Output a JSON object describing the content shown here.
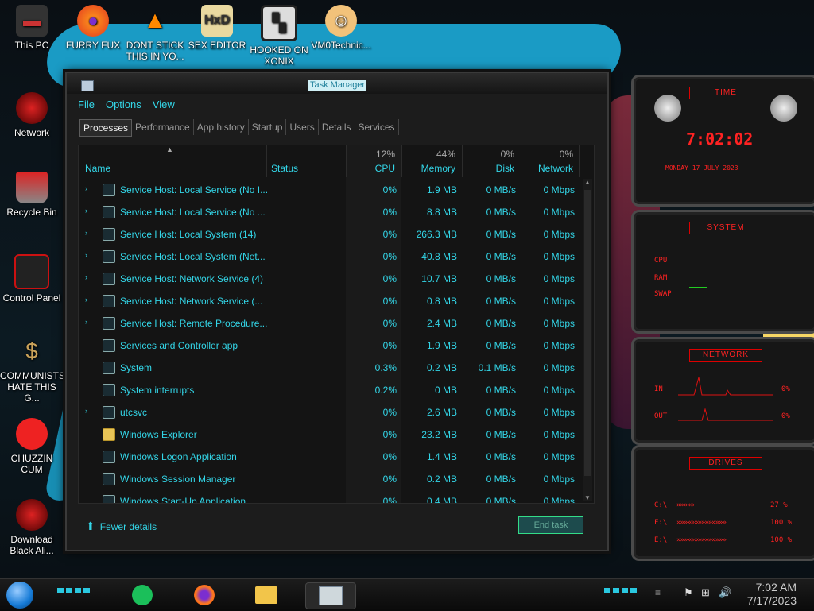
{
  "desktop": {
    "icons": [
      {
        "label": "This PC",
        "icon": "computer-icon"
      },
      {
        "label": "FURRY FUX",
        "icon": "firefox-icon"
      },
      {
        "label": "DONT STICK THIS IN YO...",
        "icon": "vlc-cone-icon"
      },
      {
        "label": "SEX EDITOR",
        "icon": "hex-editor-icon"
      },
      {
        "label": "HOOKED ON XONIX",
        "icon": "xonix-game-icon"
      },
      {
        "label": "VM0Technic...",
        "icon": "doctor-avatar-icon"
      },
      {
        "label": "Network",
        "icon": "alien-network-icon"
      },
      {
        "label": "Recycle Bin",
        "icon": "recycle-bin-icon"
      },
      {
        "label": "Control Panel",
        "icon": "control-panel-icon"
      },
      {
        "label": "COMMUNISTS HATE THIS G...",
        "icon": "money-bag-icon"
      },
      {
        "label": "CHUZZIN CUM",
        "icon": "chuzzle-icon"
      },
      {
        "label": "Download Black Ali...",
        "icon": "alien-download-icon"
      }
    ]
  },
  "task_manager": {
    "title": "Task Manager",
    "menu": [
      "File",
      "Options",
      "View"
    ],
    "tabs": [
      "Processes",
      "Performance",
      "App history",
      "Startup",
      "Users",
      "Details",
      "Services"
    ],
    "active_tab": "Processes",
    "columns": {
      "name": "Name",
      "status": "Status",
      "cpu": {
        "label": "CPU",
        "pct": "12%"
      },
      "memory": {
        "label": "Memory",
        "pct": "44%"
      },
      "disk": {
        "label": "Disk",
        "pct": "0%"
      },
      "network": {
        "label": "Network",
        "pct": "0%"
      }
    },
    "rows": [
      {
        "name": "Service Host: Local Service (No I...",
        "expandable": true,
        "icon": "gear-icon",
        "cpu": "0%",
        "memory": "1.9 MB",
        "disk": "0 MB/s",
        "network": "0 Mbps"
      },
      {
        "name": "Service Host: Local Service (No ...",
        "expandable": true,
        "icon": "gear-icon",
        "cpu": "0%",
        "memory": "8.8 MB",
        "disk": "0 MB/s",
        "network": "0 Mbps"
      },
      {
        "name": "Service Host: Local System (14)",
        "expandable": true,
        "icon": "gear-icon",
        "cpu": "0%",
        "memory": "266.3 MB",
        "disk": "0 MB/s",
        "network": "0 Mbps"
      },
      {
        "name": "Service Host: Local System (Net...",
        "expandable": true,
        "icon": "gear-icon",
        "cpu": "0%",
        "memory": "40.8 MB",
        "disk": "0 MB/s",
        "network": "0 Mbps"
      },
      {
        "name": "Service Host: Network Service (4)",
        "expandable": true,
        "icon": "gear-icon",
        "cpu": "0%",
        "memory": "10.7 MB",
        "disk": "0 MB/s",
        "network": "0 Mbps"
      },
      {
        "name": "Service Host: Network Service (...",
        "expandable": true,
        "icon": "gear-icon",
        "cpu": "0%",
        "memory": "0.8 MB",
        "disk": "0 MB/s",
        "network": "0 Mbps"
      },
      {
        "name": "Service Host: Remote Procedure...",
        "expandable": true,
        "icon": "gear-icon",
        "cpu": "0%",
        "memory": "2.4 MB",
        "disk": "0 MB/s",
        "network": "0 Mbps"
      },
      {
        "name": "Services and Controller app",
        "expandable": false,
        "icon": "app-window-icon",
        "cpu": "0%",
        "memory": "1.9 MB",
        "disk": "0 MB/s",
        "network": "0 Mbps"
      },
      {
        "name": "System",
        "expandable": false,
        "icon": "app-window-icon",
        "cpu": "0.3%",
        "memory": "0.2 MB",
        "disk": "0.1 MB/s",
        "network": "0 Mbps"
      },
      {
        "name": "System interrupts",
        "expandable": false,
        "icon": "app-window-icon",
        "cpu": "0.2%",
        "memory": "0 MB",
        "disk": "0 MB/s",
        "network": "0 Mbps"
      },
      {
        "name": "utcsvc",
        "expandable": true,
        "icon": "gear-icon",
        "cpu": "0%",
        "memory": "2.6 MB",
        "disk": "0 MB/s",
        "network": "0 Mbps"
      },
      {
        "name": "Windows Explorer",
        "expandable": false,
        "icon": "folder-icon",
        "cpu": "0%",
        "memory": "23.2 MB",
        "disk": "0 MB/s",
        "network": "0 Mbps"
      },
      {
        "name": "Windows Logon Application",
        "expandable": false,
        "icon": "app-window-icon",
        "cpu": "0%",
        "memory": "1.4 MB",
        "disk": "0 MB/s",
        "network": "0 Mbps"
      },
      {
        "name": "Windows Session Manager",
        "expandable": false,
        "icon": "app-window-icon",
        "cpu": "0%",
        "memory": "0.2 MB",
        "disk": "0 MB/s",
        "network": "0 Mbps"
      },
      {
        "name": "Windows Start-Up Application",
        "expandable": false,
        "icon": "app-window-icon",
        "cpu": "0%",
        "memory": "0.4 MB",
        "disk": "0 MB/s",
        "network": "0 Mbps"
      }
    ],
    "fewer_details": "Fewer details",
    "end_task": "End task"
  },
  "widgets": {
    "time": {
      "title": "TIME",
      "time": "7:02:02",
      "date": "MONDAY 17 JULY 2023"
    },
    "system": {
      "title": "SYSTEM",
      "labels": [
        "CPU",
        "RAM",
        "SWAP"
      ]
    },
    "network": {
      "title": "NETWORK",
      "in_label": "IN",
      "in_value": "0%",
      "out_label": "OUT",
      "out_value": "0%"
    },
    "drives": {
      "title": "DRIVES",
      "items": [
        {
          "label": "C:\\",
          "value": "27 %"
        },
        {
          "label": "F:\\",
          "value": "100 %"
        },
        {
          "label": "E:\\",
          "value": "100 %"
        }
      ]
    },
    "accent": "#ff2222"
  },
  "taskbar": {
    "apps": [
      "notes-app-icon",
      "firefox-icon",
      "file-explorer-icon",
      "task-manager-icon"
    ],
    "clock_time": "7:02 AM",
    "clock_date": "7/17/2023"
  },
  "colors": {
    "accent_cyan": "#33d6e8",
    "panel_red": "#ff2222"
  }
}
